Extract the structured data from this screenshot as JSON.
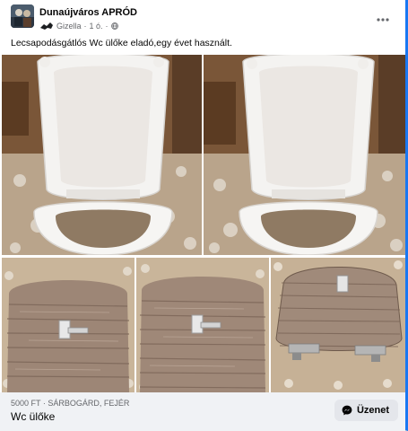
{
  "post": {
    "group_name": "Dunaújváros APRÓD",
    "author": "Gizella",
    "separator": "·",
    "time": "1 ó.",
    "text": "Lecsapodásgátlós Wc ülőke eladó,egy évet használt.",
    "more_icon": "more-options-icon",
    "privacy_icon": "globe-icon"
  },
  "listing": {
    "price_location": "5000 FT · SÁRBOGÁRD, FEJÉR",
    "title": "Wc ülőke",
    "message_label": "Üzenet",
    "message_icon": "messenger-icon"
  },
  "photos": [
    {
      "subject": "toilet-seat-open-white"
    },
    {
      "subject": "toilet-seat-open-white"
    },
    {
      "subject": "toilet-seat-lid-woodgrain"
    },
    {
      "subject": "toilet-seat-lid-woodgrain"
    },
    {
      "subject": "toilet-seat-lid-woodgrain-hinges"
    }
  ],
  "colors": {
    "accent": "#1877f2",
    "footer_bg": "#f0f2f5",
    "button_bg": "#e4e6eb",
    "secondary_text": "#65676b"
  }
}
